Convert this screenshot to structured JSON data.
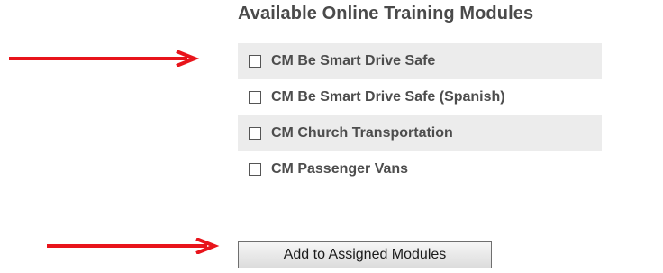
{
  "heading": "Available Online Training Modules",
  "modules": [
    {
      "label": "CM Be Smart Drive Safe",
      "checked": false
    },
    {
      "label": "CM Be Smart Drive Safe (Spanish)",
      "checked": false
    },
    {
      "label": "CM Church Transportation",
      "checked": false
    },
    {
      "label": "CM Passenger Vans",
      "checked": false
    }
  ],
  "add_button_label": "Add to Assigned Modules",
  "colors": {
    "arrow": "#e8141b",
    "row_shade": "#ececec",
    "text": "#4d4d4d"
  },
  "icons": {
    "annotation_arrow": "right-arrow-icon"
  }
}
